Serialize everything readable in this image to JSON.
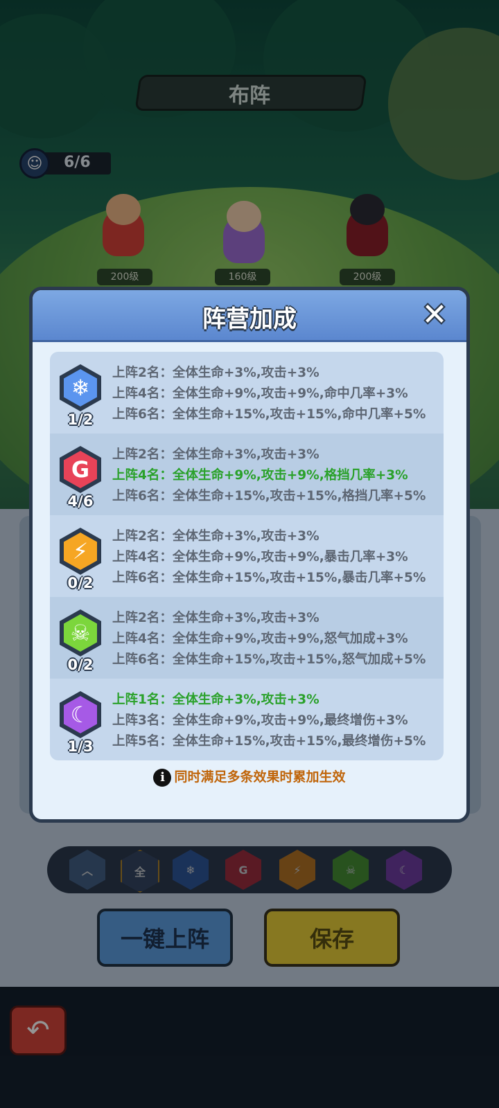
{
  "screen": {
    "title": "布阵",
    "roster_count": "6/6",
    "hero_levels": [
      "200级",
      "160级",
      "200级"
    ]
  },
  "filters": [
    {
      "name": "up",
      "glyph": "︿",
      "color": "#4b6f9c"
    },
    {
      "name": "all",
      "glyph": "全",
      "color": "#3a4c6b"
    },
    {
      "name": "ice",
      "glyph": "❄",
      "color": "#2f62b8"
    },
    {
      "name": "g",
      "glyph": "G",
      "color": "#c62a3a"
    },
    {
      "name": "lightning",
      "glyph": "⚡",
      "color": "#e58a17"
    },
    {
      "name": "skull",
      "glyph": "☠",
      "color": "#4fae2c"
    },
    {
      "name": "moon",
      "glyph": "☾",
      "color": "#8a3fc4"
    }
  ],
  "buttons": {
    "auto_deploy": "一键上阵",
    "save": "保存"
  },
  "modal": {
    "title": "阵营加成",
    "close_glyph": "✕",
    "note": "同时满足多条效果时累加生效",
    "note_icon": "i",
    "factions": [
      {
        "icon": "snowflake-icon",
        "glyph": "❄",
        "color": "#2e63c8",
        "inner": "#5b95ef",
        "count": "1/2",
        "lines": [
          {
            "text": "上阵2名：全体生命+3%,攻击+3%",
            "active": false
          },
          {
            "text": "上阵4名：全体生命+9%,攻击+9%,命中几率+3%",
            "active": false
          },
          {
            "text": "上阵6名：全体生命+15%,攻击+15%,命中几率+5%",
            "active": false
          }
        ]
      },
      {
        "icon": "g-shield-icon",
        "glyph": "G",
        "color": "#b81d30",
        "inner": "#e84358",
        "count": "4/6",
        "lines": [
          {
            "text": "上阵2名：全体生命+3%,攻击+3%",
            "active": false
          },
          {
            "text": "上阵4名：全体生命+9%,攻击+9%,格挡几率+3%",
            "active": true
          },
          {
            "text": "上阵6名：全体生命+15%,攻击+15%,格挡几率+5%",
            "active": false
          }
        ]
      },
      {
        "icon": "lightning-icon",
        "glyph": "⚡",
        "color": "#e27a0f",
        "inner": "#f6a623",
        "count": "0/2",
        "lines": [
          {
            "text": "上阵2名：全体生命+3%,攻击+3%",
            "active": false
          },
          {
            "text": "上阵4名：全体生命+9%,攻击+9%,暴击几率+3%",
            "active": false
          },
          {
            "text": "上阵6名：全体生命+15%,攻击+15%,暴击几率+5%",
            "active": false
          }
        ]
      },
      {
        "icon": "skull-icon",
        "glyph": "☠",
        "color": "#43a020",
        "inner": "#7cd63c",
        "count": "0/2",
        "lines": [
          {
            "text": "上阵2名：全体生命+3%,攻击+3%",
            "active": false
          },
          {
            "text": "上阵4名：全体生命+9%,攻击+9%,怒气加成+3%",
            "active": false
          },
          {
            "text": "上阵6名：全体生命+15%,攻击+15%,怒气加成+5%",
            "active": false
          }
        ]
      },
      {
        "icon": "sun-moon-icon",
        "glyph": "☾",
        "color": "#7a2fbf",
        "inner": "#a65ae6",
        "count": "1/3",
        "lines": [
          {
            "text": "上阵1名：全体生命+3%,攻击+3%",
            "active": true
          },
          {
            "text": "上阵3名：全体生命+9%,攻击+9%,最终增伤+3%",
            "active": false
          },
          {
            "text": "上阵5名：全体生命+15%,攻击+15%,最终增伤+5%",
            "active": false
          }
        ]
      }
    ]
  }
}
